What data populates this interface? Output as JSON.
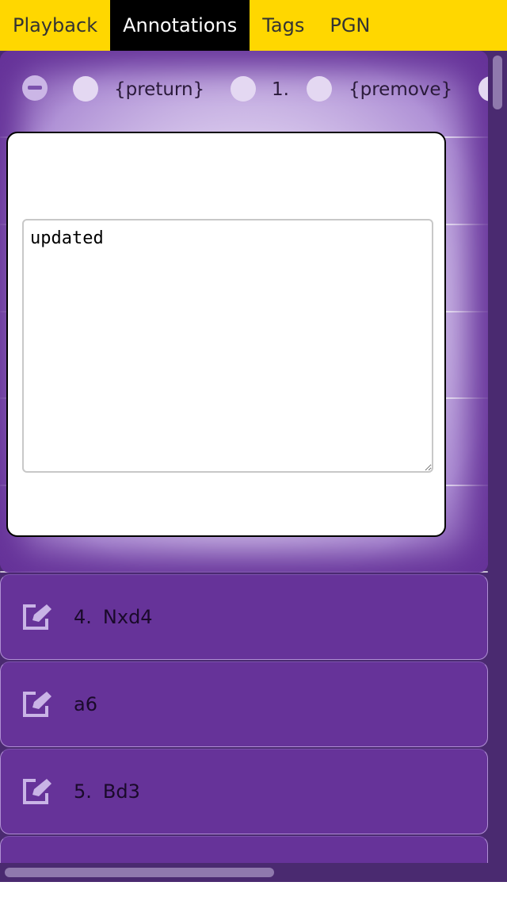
{
  "tabs": [
    {
      "label": "Playback"
    },
    {
      "label": "Annotations",
      "active": true
    },
    {
      "label": "Tags"
    },
    {
      "label": "PGN"
    }
  ],
  "move_strip": {
    "preturn": "{preturn}",
    "move_number": "1.",
    "premove": "{premove}"
  },
  "editor": {
    "text": "updated"
  },
  "rows": [
    {
      "number": "4.",
      "move": "Nxd4"
    },
    {
      "number": "",
      "move": "a6"
    },
    {
      "number": "5.",
      "move": "Bd3"
    },
    {
      "number": "",
      "move": ""
    }
  ],
  "colors": {
    "tab_bar": "#ffd700",
    "tab_active": "#000000",
    "row": "#663399",
    "background": "#4a2a70"
  },
  "icons": {
    "row": "edit-icon",
    "collapse": "minus-circle-icon"
  }
}
